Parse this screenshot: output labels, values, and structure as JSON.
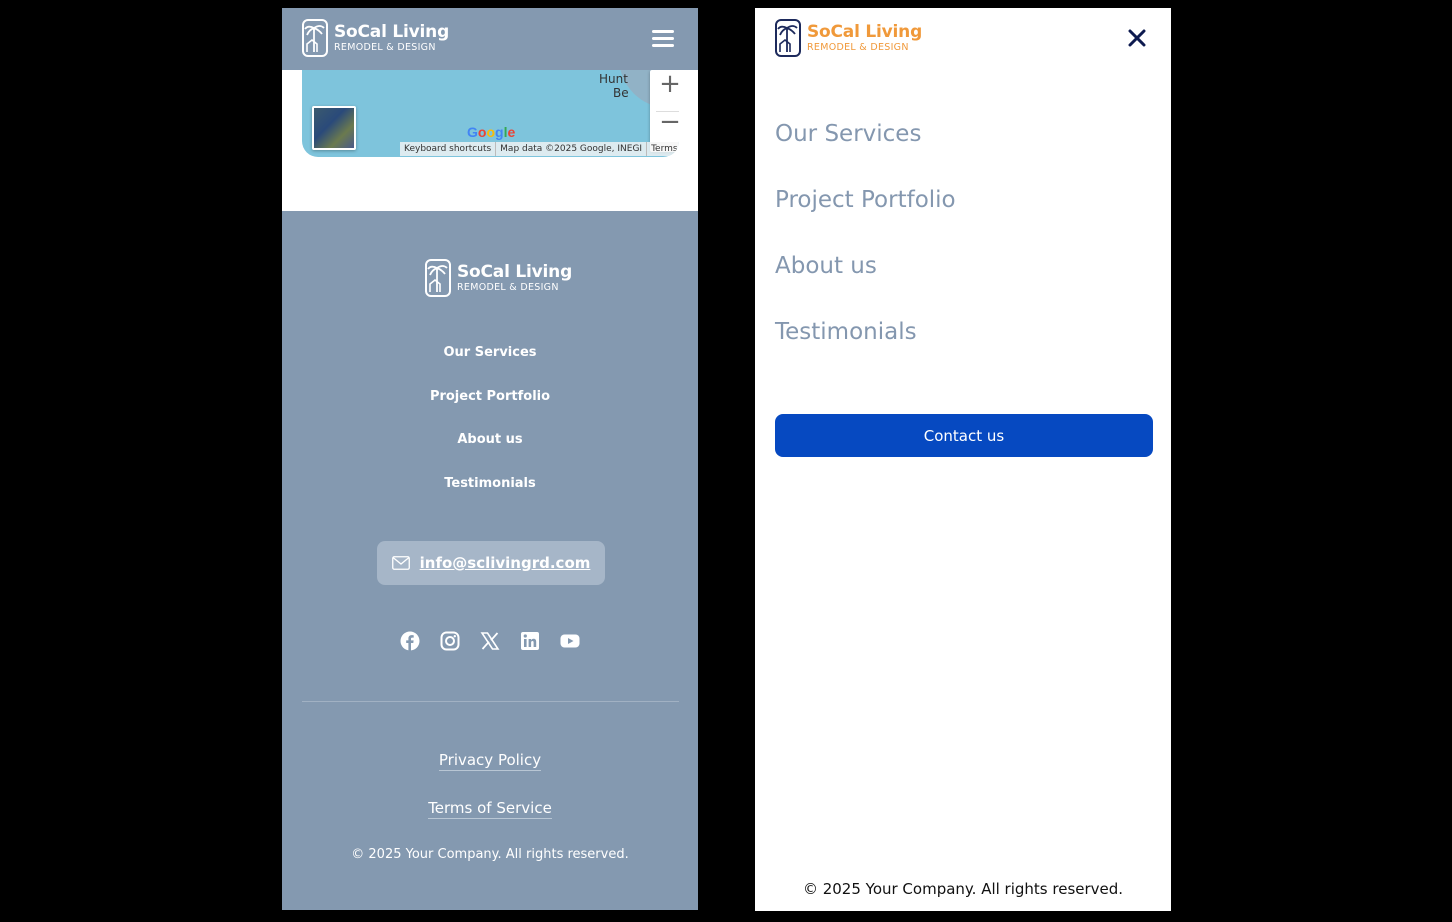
{
  "brand": {
    "name": "SoCal Living",
    "tagline": "REMODEL & DESIGN"
  },
  "map": {
    "city_line1": "Hunt",
    "city_line2": "Be",
    "zoom_in": "+",
    "zoom_out": "−",
    "google": [
      "G",
      "o",
      "o",
      "g",
      "l",
      "e"
    ],
    "attribution": [
      "Keyboard shortcuts",
      "Map data ©2025 Google, INEGI",
      "Terms"
    ]
  },
  "footer": {
    "nav": [
      "Our Services",
      "Project Portfolio",
      "About us",
      "Testimonials"
    ],
    "email": "info@sclivingrd.com",
    "social_icons": [
      "facebook-icon",
      "instagram-icon",
      "x-icon",
      "linkedin-icon",
      "youtube-icon"
    ],
    "privacy": "Privacy Policy",
    "terms": "Terms of Service",
    "copyright": "© 2025 Your Company. All rights reserved."
  },
  "menu": {
    "items": [
      "Our Services",
      "Project Portfolio",
      "About us",
      "Testimonials"
    ],
    "contact_label": "Contact us",
    "copyright": "© 2025 Your Company. All rights reserved."
  },
  "colors": {
    "header_bg": "#8499b0",
    "accent_blue": "#0649c1",
    "logo_orange": "#f0993a",
    "menu_text": "#8497af"
  }
}
